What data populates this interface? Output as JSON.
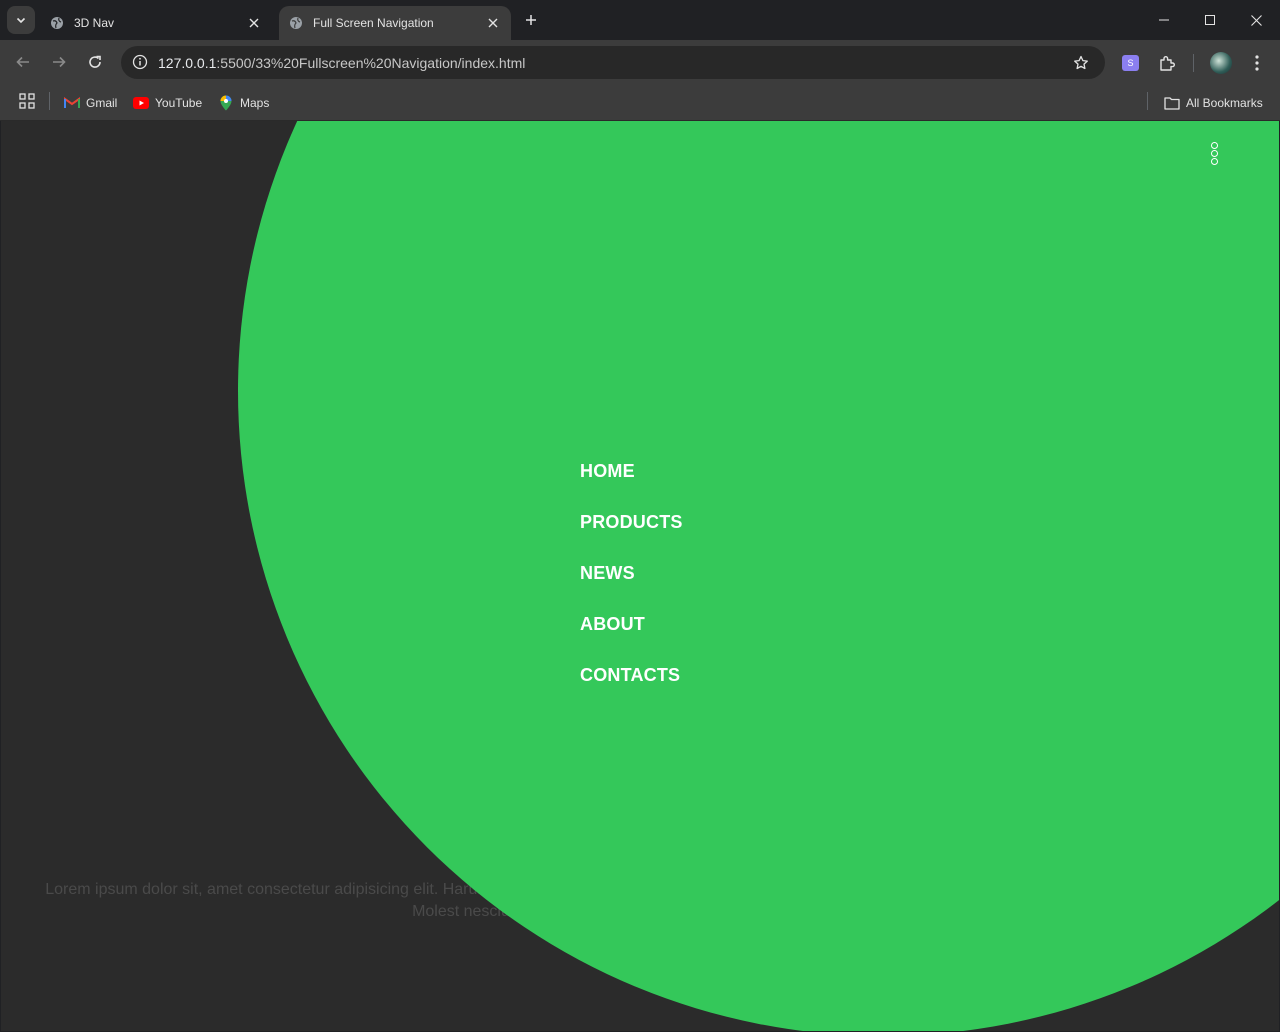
{
  "browser": {
    "tabs": [
      {
        "title": "3D Nav",
        "active": false
      },
      {
        "title": "Full Screen Navigation",
        "active": true
      }
    ],
    "url_host": "127.0.0.1",
    "url_rest": ":5500/33%20Fullscreen%20Navigation/index.html",
    "bookmarks": [
      {
        "label": "Gmail",
        "icon": "gmail-icon"
      },
      {
        "label": "YouTube",
        "icon": "youtube-icon"
      },
      {
        "label": "Maps",
        "icon": "maps-icon"
      }
    ],
    "all_bookmarks": "All Bookmarks",
    "extension_badge": "S"
  },
  "page": {
    "menu": [
      "HOME",
      "PRODUCTS",
      "NEWS",
      "ABOUT",
      "CONTACTS"
    ],
    "lorem": "Lorem ipsum dolor sit, amet consectetur adipisicing elit. Harum neque aut nobis laboriosam quos tenetur doloribus corrupti! Molest nesciunt a a",
    "accent_color": "#34c85a",
    "background_color": "#2b2b2b",
    "toggle_icon": "dots-vertical-icon"
  }
}
